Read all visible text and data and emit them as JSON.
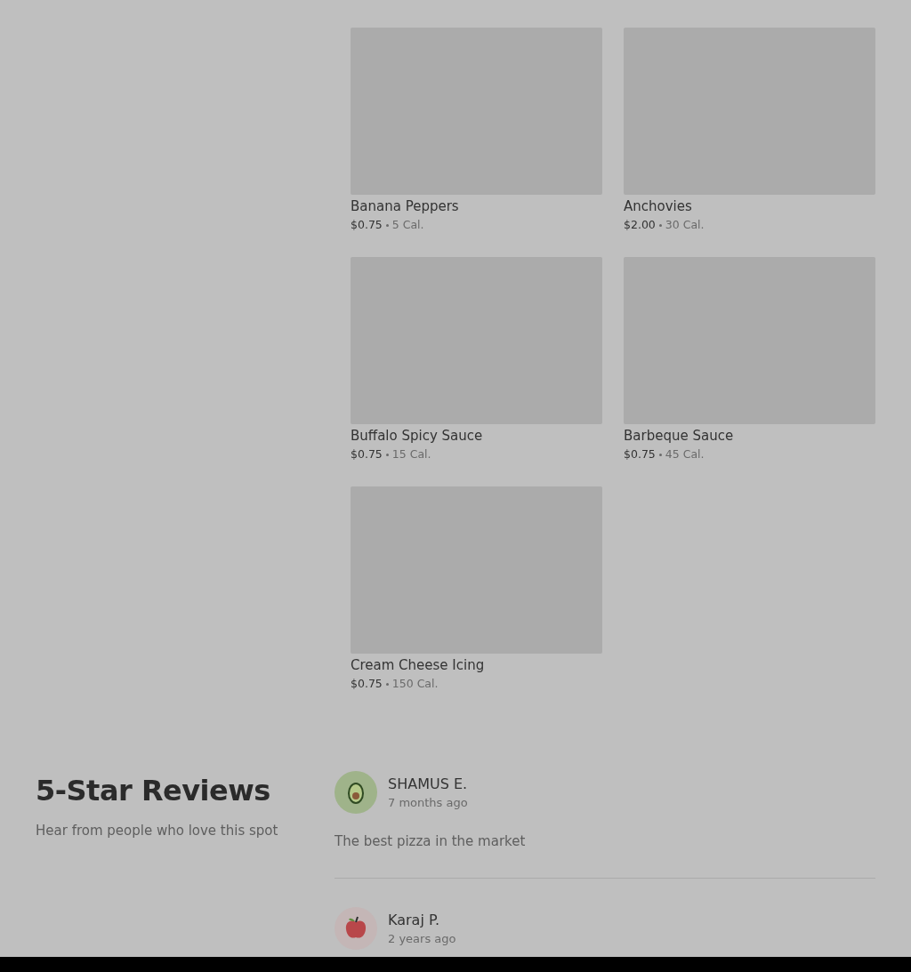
{
  "menu_items": [
    {
      "name": "Banana Peppers",
      "price": "$0.75",
      "calories": "5 Cal."
    },
    {
      "name": "Anchovies",
      "price": "$2.00",
      "calories": "30 Cal."
    },
    {
      "name": "Buffalo Spicy Sauce",
      "price": "$0.75",
      "calories": "15 Cal."
    },
    {
      "name": "Barbeque Sauce",
      "price": "$0.75",
      "calories": "45 Cal."
    },
    {
      "name": "Cream Cheese Icing",
      "price": "$0.75",
      "calories": "150 Cal."
    }
  ],
  "reviews_section": {
    "title": "5-Star Reviews",
    "subtitle": "Hear from people who love this spot",
    "reviews": [
      {
        "kind": "avocado",
        "name": "SHAMUS E.",
        "time": "7 months ago",
        "text": "The best pizza in the market"
      },
      {
        "kind": "apple",
        "name": "Karaj P.",
        "time": "2 years ago"
      }
    ]
  }
}
